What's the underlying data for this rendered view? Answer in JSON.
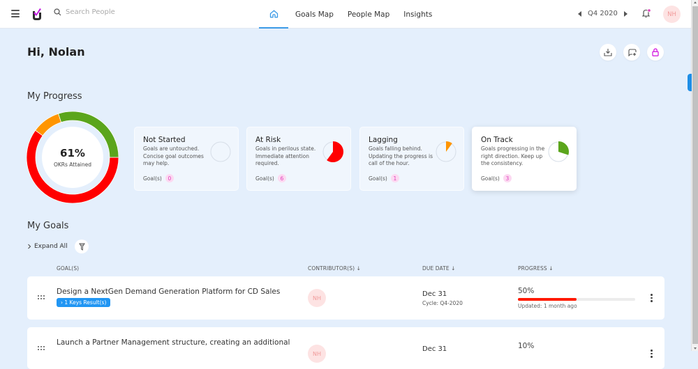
{
  "header": {
    "search_placeholder": "Search People",
    "nav": [
      {
        "label": "Goals Map"
      },
      {
        "label": "People Map"
      },
      {
        "label": "Insights"
      }
    ],
    "cycle": "Q4 2020",
    "user_initials": "NH",
    "notification_dot_color": "#e13fbd"
  },
  "greeting": "Hi, Nolan",
  "progress": {
    "title": "My Progress",
    "percent": "61%",
    "percent_label": "OKRs Attained",
    "cards": [
      {
        "title": "Not Started",
        "desc": "Goals are untouched. Concise goal outcomes may help.",
        "goals_label": "Goal(s)",
        "count": "0",
        "color": "#cccccc"
      },
      {
        "title": "At Risk",
        "desc": "Goals in perilous state. Immediate attention required.",
        "goals_label": "Goal(s)",
        "count": "6",
        "color": "#ff0000"
      },
      {
        "title": "Lagging",
        "desc": "Goals falling behind. Updating the progress is call of the hour.",
        "goals_label": "Goal(s)",
        "count": "1",
        "color": "#ff9500"
      },
      {
        "title": "On Track",
        "desc": "Goals progressing in the right direction. Keep up the consistency.",
        "goals_label": "Goal(s)",
        "count": "3",
        "color": "#5ba51c"
      }
    ]
  },
  "chart_data": {
    "type": "pie",
    "title": "OKRs Attained",
    "categories": [
      "At Risk",
      "Lagging",
      "On Track",
      "Not Started"
    ],
    "values": [
      6,
      1,
      3,
      0
    ],
    "colors": [
      "#ff0000",
      "#ff9500",
      "#5ba51c",
      "#cccccc"
    ],
    "center_label": "61%"
  },
  "goals": {
    "title": "My Goals",
    "expand_all": "Expand All",
    "columns": {
      "goal": "GOAL(S)",
      "contributor": "CONTRIBUTOR(S) ↓",
      "due_date": "DUE DATE ↓",
      "progress": "PROGRESS ↓"
    },
    "rows": [
      {
        "title": "Design a NextGen Demand Generation Platform for CD Sales",
        "key_results": "1 Keys Result(s)",
        "contributor": "NH",
        "due": "Dec 31",
        "cycle": "Cycle: Q4-2020",
        "progress": "50%",
        "progress_value": 0.5,
        "updated": "Updated: 1 month ago"
      },
      {
        "title": "Launch a Partner Management structure, creating an additional",
        "contributor": "NH",
        "due": "Dec 31",
        "progress": "10%",
        "progress_value": 0.1
      }
    ]
  }
}
